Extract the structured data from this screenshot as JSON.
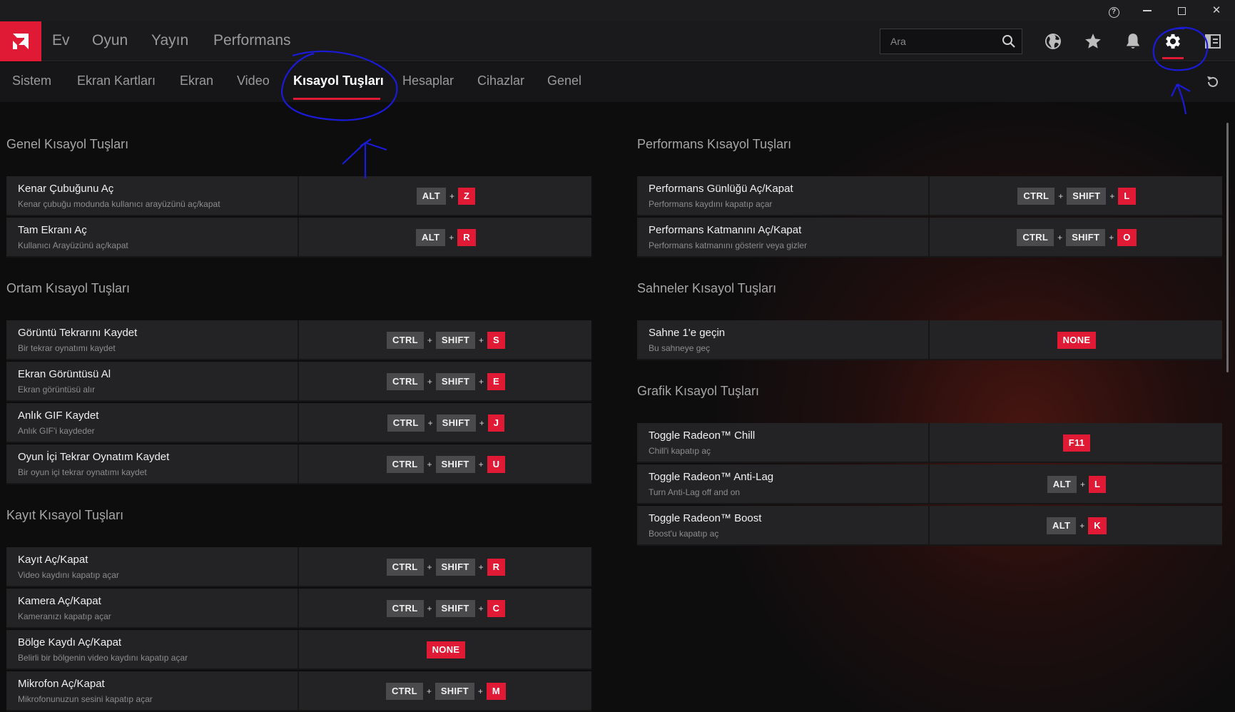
{
  "window": {
    "help": "?",
    "minimize": "",
    "maximize": "",
    "close": "✕"
  },
  "nav": {
    "items": [
      "Ev",
      "Oyun",
      "Yayın",
      "Performans"
    ],
    "search_placeholder": "Ara"
  },
  "subnav": {
    "tabs": [
      "Sistem",
      "Ekran Kartları",
      "Ekran",
      "Video",
      "Kısayol Tuşları",
      "Hesaplar",
      "Cihazlar",
      "Genel"
    ],
    "active": "Kısayol Tuşları"
  },
  "sections": {
    "genel": {
      "title": "Genel Kısayol Tuşları",
      "rows": [
        {
          "title": "Kenar Çubuğunu Aç",
          "sub": "Kenar çubuğu modunda kullanıcı arayüzünü aç/kapat",
          "keys": [
            "ALT",
            "Z"
          ]
        },
        {
          "title": "Tam Ekranı Aç",
          "sub": "Kullanıcı Arayüzünü aç/kapat",
          "keys": [
            "ALT",
            "R"
          ]
        }
      ]
    },
    "ortam": {
      "title": "Ortam Kısayol Tuşları",
      "rows": [
        {
          "title": "Görüntü Tekrarını Kaydet",
          "sub": "Bir tekrar oynatımı kaydet",
          "keys": [
            "CTRL",
            "SHIFT",
            "S"
          ]
        },
        {
          "title": "Ekran Görüntüsü Al",
          "sub": "Ekran görüntüsü alır",
          "keys": [
            "CTRL",
            "SHIFT",
            "E"
          ]
        },
        {
          "title": "Anlık GIF Kaydet",
          "sub": "Anlık GIF'i kaydeder",
          "keys": [
            "CTRL",
            "SHIFT",
            "J"
          ]
        },
        {
          "title": "Oyun İçi Tekrar Oynatım Kaydet",
          "sub": "Bir oyun içi tekrar oynatımı kaydet",
          "keys": [
            "CTRL",
            "SHIFT",
            "U"
          ]
        }
      ]
    },
    "kayit": {
      "title": "Kayıt Kısayol Tuşları",
      "rows": [
        {
          "title": "Kayıt Aç/Kapat",
          "sub": "Video kaydını kapatıp açar",
          "keys": [
            "CTRL",
            "SHIFT",
            "R"
          ]
        },
        {
          "title": "Kamera Aç/Kapat",
          "sub": "Kameranızı kapatıp açar",
          "keys": [
            "CTRL",
            "SHIFT",
            "C"
          ]
        },
        {
          "title": "Bölge Kaydı Aç/Kapat",
          "sub": "Belirli bir bölgenin video kaydını kapatıp açar",
          "keys": [
            "NONE"
          ]
        },
        {
          "title": "Mikrofon Aç/Kapat",
          "sub": "Mikrofonunuzun sesini kapatıp açar",
          "keys": [
            "CTRL",
            "SHIFT",
            "M"
          ]
        }
      ]
    },
    "performans": {
      "title": "Performans Kısayol Tuşları",
      "rows": [
        {
          "title": "Performans Günlüğü Aç/Kapat",
          "sub": "Performans kaydını kapatıp açar",
          "keys": [
            "CTRL",
            "SHIFT",
            "L"
          ]
        },
        {
          "title": "Performans Katmanını Aç/Kapat",
          "sub": "Performans katmanını gösterir veya gizler",
          "keys": [
            "CTRL",
            "SHIFT",
            "O"
          ]
        }
      ]
    },
    "sahneler": {
      "title": "Sahneler Kısayol Tuşları",
      "rows": [
        {
          "title": "Sahne 1'e geçin",
          "sub": "Bu sahneye geç",
          "keys": [
            "NONE"
          ]
        }
      ]
    },
    "grafik": {
      "title": "Grafik Kısayol Tuşları",
      "rows": [
        {
          "title": "Toggle Radeon™ Chill",
          "sub": "Chill'i kapatıp aç",
          "keys": [
            "F11"
          ]
        },
        {
          "title": "Toggle Radeon™ Anti-Lag",
          "sub": "Turn Anti-Lag off and on",
          "keys": [
            "ALT",
            "L"
          ]
        },
        {
          "title": "Toggle Radeon™ Boost",
          "sub": "Boost'u kapatıp aç",
          "keys": [
            "ALT",
            "K"
          ]
        }
      ]
    }
  },
  "icons": [
    "amd-logo-icon",
    "search-icon",
    "globe-icon",
    "star-icon",
    "bell-icon",
    "gear-icon",
    "panel-icon",
    "reset-icon"
  ],
  "colors": {
    "accent": "#e01935",
    "key_mod": "#4a4a4c",
    "row_bg": "#232325",
    "annotation": "#1a1ad8"
  }
}
